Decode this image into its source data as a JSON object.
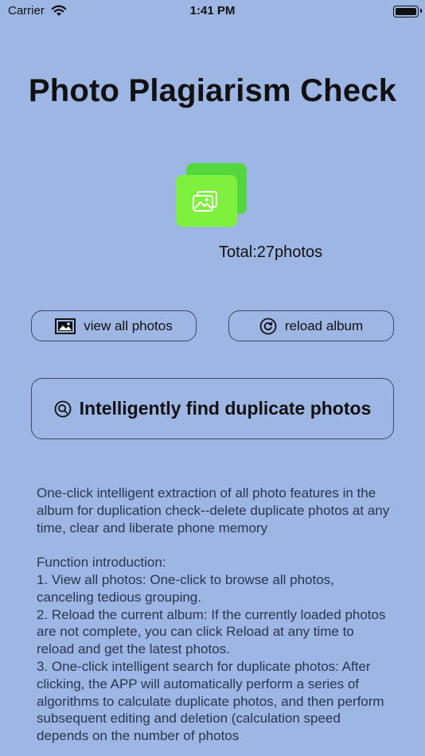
{
  "status_bar": {
    "carrier": "Carrier",
    "time": "1:41 PM"
  },
  "title": "Photo Plagiarism Check",
  "total": "Total:27photos",
  "buttons": {
    "view_all": "view all photos",
    "reload": "reload album",
    "find_duplicates": "Intelligently find duplicate photos"
  },
  "description": {
    "intro": "One-click intelligent extraction of all photo features in the album for duplication check--delete duplicate photos at any time, clear and liberate phone memory",
    "heading": "Function introduction:",
    "items": [
      "1. View all photos: One-click to browse all photos, canceling tedious grouping.",
      "2. Reload the current album: If the currently loaded photos are not complete, you can click Reload at any time to reload and get the latest photos.",
      "3. One-click intelligent search for duplicate photos: After clicking, the APP will automatically perform a series of algorithms to calculate duplicate photos, and then perform subsequent editing and deletion (calculation speed depends on the number of photos"
    ]
  },
  "colors": {
    "background": "#9db6e3",
    "album_back": "#54d63e",
    "album_front": "#80f03e",
    "button_border": "#3c4a66"
  },
  "icons": [
    "wifi-icon",
    "battery-icon",
    "album-icon",
    "photo-icon",
    "reload-icon",
    "search-icon"
  ]
}
